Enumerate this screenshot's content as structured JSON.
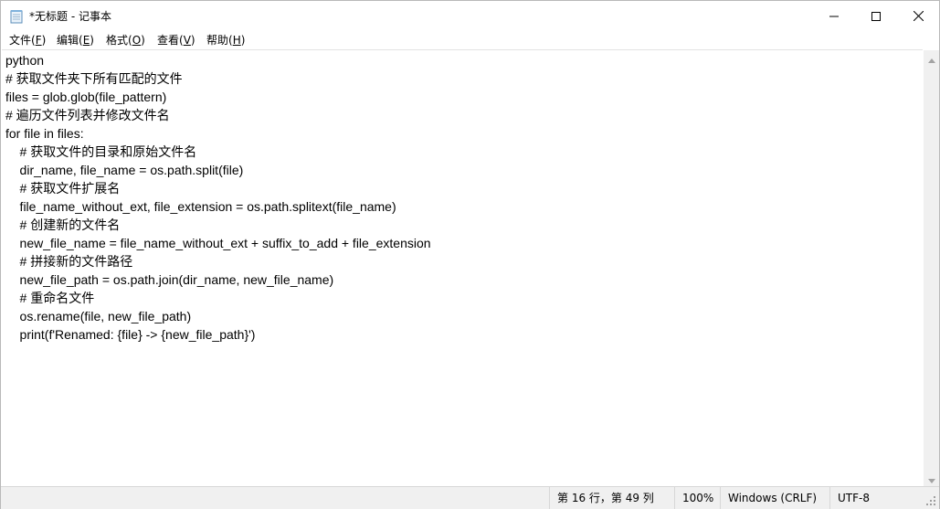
{
  "window": {
    "title": "*无标题 - 记事本",
    "icon": "notepad-icon",
    "controls": [
      "minimize-icon",
      "maximize-icon",
      "close-icon"
    ]
  },
  "menu": [
    {
      "label": "文件(",
      "key": "F",
      "end": ")"
    },
    {
      "label": "编辑(",
      "key": "E",
      "end": ")"
    },
    {
      "label": "格式(",
      "key": "O",
      "end": ")"
    },
    {
      "label": "查看(",
      "key": "V",
      "end": ")"
    },
    {
      "label": "帮助(",
      "key": "H",
      "end": ")"
    }
  ],
  "editor": {
    "lines": [
      "python",
      "# 获取文件夹下所有匹配的文件",
      "files = glob.glob(file_pattern)",
      "# 遍历文件列表并修改文件名",
      "for file in files:",
      "    # 获取文件的目录和原始文件名",
      "    dir_name, file_name = os.path.split(file)",
      "    # 获取文件扩展名",
      "    file_name_without_ext, file_extension = os.path.splitext(file_name)",
      "    # 创建新的文件名",
      "    new_file_name = file_name_without_ext + suffix_to_add + file_extension",
      "    # 拼接新的文件路径",
      "    new_file_path = os.path.join(dir_name, new_file_name)",
      "    # 重命名文件",
      "    os.rename(file, new_file_path)",
      "    print(f'Renamed: {file} -> {new_file_path}')"
    ]
  },
  "status": {
    "position": "第 16 行，第 49 列",
    "zoom": "100%",
    "line_ending": "Windows (CRLF)",
    "encoding": "UTF-8"
  }
}
